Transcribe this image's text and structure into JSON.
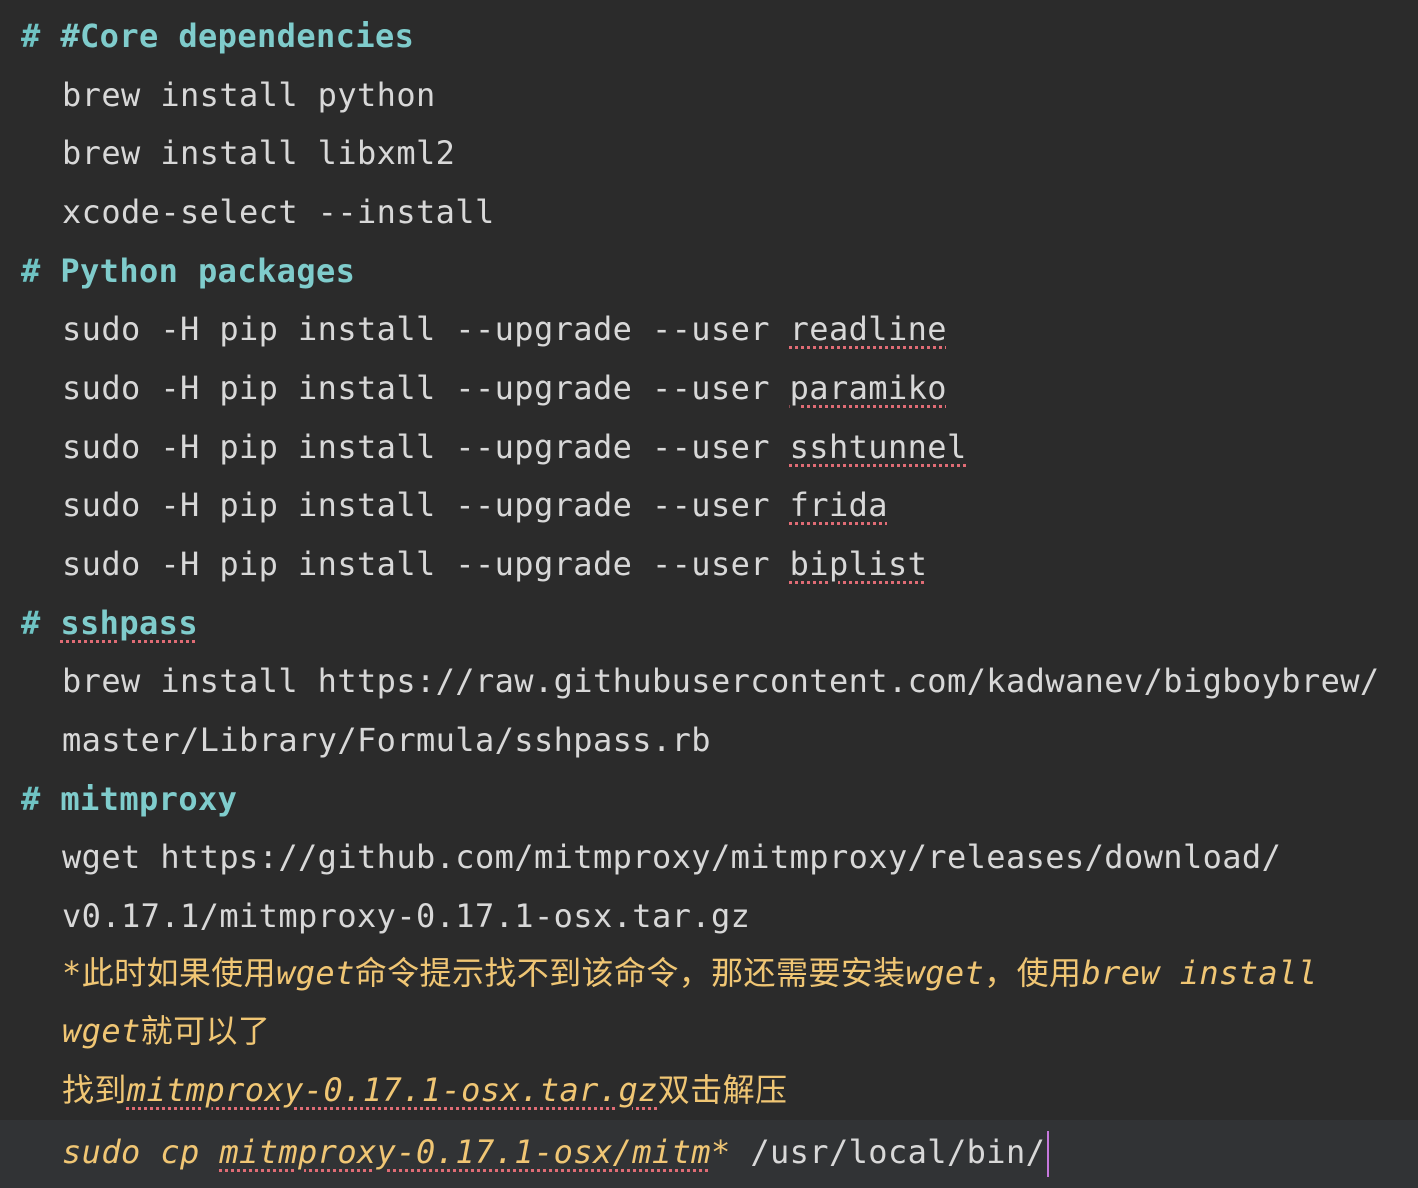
{
  "editor": {
    "lines": [
      {
        "segments": [
          {
            "t": "# "
          },
          {
            "t": "#Core dependencies"
          }
        ]
      },
      {
        "segments": [
          {
            "t": "brew install python"
          }
        ]
      },
      {
        "segments": [
          {
            "t": "brew install libxml2"
          }
        ]
      },
      {
        "segments": [
          {
            "t": "xcode-select --install"
          }
        ]
      },
      {
        "segments": [
          {
            "t": "# "
          },
          {
            "t": "Python packages"
          }
        ]
      },
      {
        "segments": [
          {
            "t": "sudo -H pip install --upgrade --user "
          },
          {
            "t": "readline"
          }
        ]
      },
      {
        "segments": [
          {
            "t": "sudo -H pip install --upgrade --user "
          },
          {
            "t": "paramiko"
          }
        ]
      },
      {
        "segments": [
          {
            "t": "sudo -H pip install --upgrade --user "
          },
          {
            "t": "sshtunnel"
          }
        ]
      },
      {
        "segments": [
          {
            "t": "sudo -H pip install --upgrade --user "
          },
          {
            "t": "frida"
          }
        ]
      },
      {
        "segments": [
          {
            "t": "sudo -H pip install --upgrade --user "
          },
          {
            "t": "biplist"
          }
        ]
      },
      {
        "segments": [
          {
            "t": "# "
          },
          {
            "t": "sshpass"
          }
        ]
      },
      {
        "segments": [
          {
            "t": "brew install https://raw.githubusercontent.com/kadwanev/bigboybrew/"
          }
        ]
      },
      {
        "segments": [
          {
            "t": "master/Library/Formula/sshpass.rb"
          }
        ]
      },
      {
        "segments": [
          {
            "t": "# "
          },
          {
            "t": "mitmproxy"
          }
        ]
      },
      {
        "segments": [
          {
            "t": "wget https://github.com/mitmproxy/mitmproxy/releases/download/"
          }
        ]
      },
      {
        "segments": [
          {
            "t": "v0.17.1/mitmproxy-0.17.1-osx.tar.gz"
          }
        ]
      },
      {
        "segments": [
          {
            "t": "*"
          },
          {
            "t": "此时如果使用"
          },
          {
            "t": "wget"
          },
          {
            "t": "命令提示找不到该命令，那还需要安装"
          },
          {
            "t": "wget"
          },
          {
            "t": "，使用"
          },
          {
            "t": "brew install"
          }
        ]
      },
      {
        "segments": [
          {
            "t": "wget"
          },
          {
            "t": "就可以了"
          }
        ]
      },
      {
        "segments": [
          {
            "t": "找到"
          },
          {
            "t": "mitmproxy-0.17.1-osx.tar.gz"
          },
          {
            "t": "双击解压"
          }
        ]
      },
      {
        "segments": [
          {
            "t": "sudo cp "
          },
          {
            "t": "mitmproxy-0.17.1-osx/mitm"
          },
          {
            "t": "* "
          },
          {
            "t": "/usr/local/bin/"
          }
        ]
      }
    ]
  }
}
